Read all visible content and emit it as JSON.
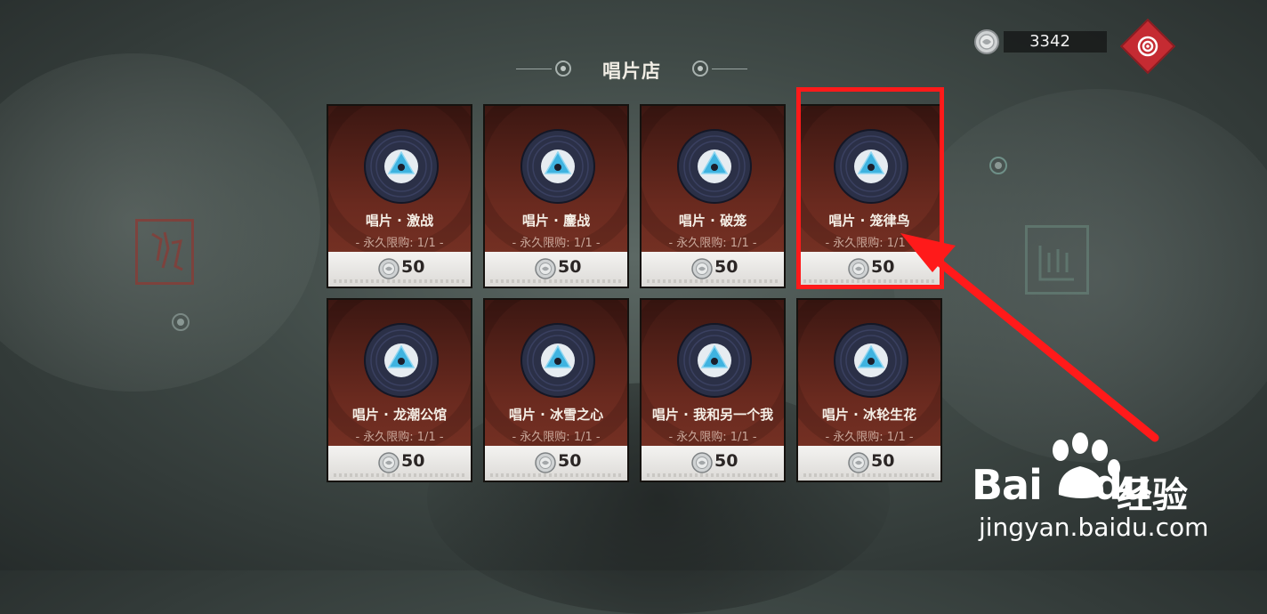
{
  "header": {
    "title": "唱片店"
  },
  "currency": {
    "icon": "silver-coin-icon",
    "amount": "3342"
  },
  "menu_button": {
    "icon": "spiral-menu-icon",
    "color": "#c52b32"
  },
  "shop": {
    "items": [
      {
        "name": "唱片 · 激战",
        "limit": "- 永久限购: 1/1 -",
        "price": "50"
      },
      {
        "name": "唱片 · 鏖战",
        "limit": "- 永久限购: 1/1 -",
        "price": "50"
      },
      {
        "name": "唱片 · 破笼",
        "limit": "- 永久限购: 1/1 -",
        "price": "50"
      },
      {
        "name": "唱片 · 笼律鸟",
        "limit": "- 永久限购: 1/1 -",
        "price": "50"
      },
      {
        "name": "唱片 · 龙潮公馆",
        "limit": "- 永久限购: 1/1 -",
        "price": "50"
      },
      {
        "name": "唱片 · 冰雪之心",
        "limit": "- 永久限购: 1/1 -",
        "price": "50"
      },
      {
        "name": "唱片 · 我和另一个我",
        "limit": "- 永久限购: 1/1 -",
        "price": "50"
      },
      {
        "name": "唱片 · 冰轮生花",
        "limit": "- 永久限购: 1/1 -",
        "price": "50"
      }
    ]
  },
  "annotation": {
    "highlight_color": "#ff1a1a",
    "highlighted_item_index": 3
  },
  "watermark": {
    "logo": "Bai",
    "logo_du": "du",
    "cn": "经验",
    "url": "jingyan.baidu.com"
  }
}
